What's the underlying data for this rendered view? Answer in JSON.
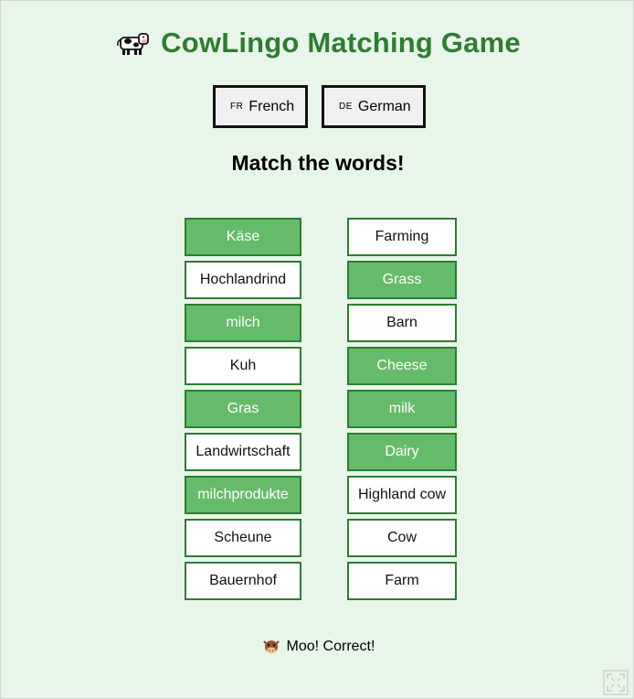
{
  "header": {
    "icon": "cow-icon",
    "title": "CowLingo Matching Game"
  },
  "languages": [
    {
      "code": "FR",
      "label": "French"
    },
    {
      "code": "DE",
      "label": "German"
    }
  ],
  "prompt": "Match the words!",
  "left_words": [
    {
      "text": "Käse",
      "matched": true
    },
    {
      "text": "Hochlandrind",
      "matched": false
    },
    {
      "text": "milch",
      "matched": true
    },
    {
      "text": "Kuh",
      "matched": false
    },
    {
      "text": "Gras",
      "matched": true
    },
    {
      "text": "Landwirtschaft",
      "matched": false
    },
    {
      "text": "milchprodukte",
      "matched": true
    },
    {
      "text": "Scheune",
      "matched": false
    },
    {
      "text": "Bauernhof",
      "matched": false
    }
  ],
  "right_words": [
    {
      "text": "Farming",
      "matched": false
    },
    {
      "text": "Grass",
      "matched": true
    },
    {
      "text": "Barn",
      "matched": false
    },
    {
      "text": "Cheese",
      "matched": true
    },
    {
      "text": "milk",
      "matched": true
    },
    {
      "text": "Dairy",
      "matched": true
    },
    {
      "text": "Highland cow",
      "matched": false
    },
    {
      "text": "Cow",
      "matched": false
    },
    {
      "text": "Farm",
      "matched": false
    }
  ],
  "feedback": {
    "icon": "cow-face-icon",
    "text": "Moo! Correct!"
  },
  "colors": {
    "background": "#e8f5e9",
    "title": "#2e7d32",
    "matched": "#66bb6a",
    "border": "#2e7d32"
  }
}
